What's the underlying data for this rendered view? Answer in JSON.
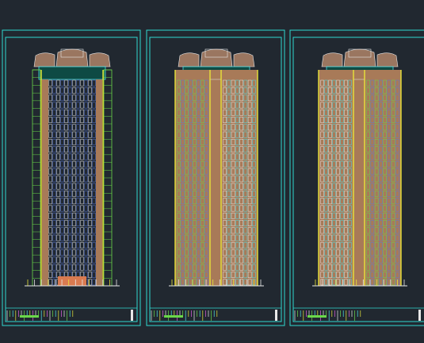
{
  "canvas": {
    "background": "#212830"
  },
  "colors": {
    "frame": "#2fd8d0",
    "line_yellow": "#e8e43a",
    "line_cyan": "#4fe0e8",
    "line_blue": "#5a7ad8",
    "line_green": "#6ad84a",
    "line_white": "#e8e8e8",
    "facade_brown": "#a87a58",
    "roof_brown": "#9a7660",
    "glass_teal": "#0e4a44",
    "base_orange": "#d87a50"
  },
  "sheets": [
    {
      "id": "elevation-sheet-1",
      "floors": 28,
      "style": "symmetric",
      "title_text": ""
    },
    {
      "id": "elevation-sheet-2",
      "floors": 28,
      "style": "split",
      "title_text": ""
    },
    {
      "id": "elevation-sheet-3",
      "floors": 28,
      "style": "split-mirrored",
      "title_text": ""
    }
  ]
}
